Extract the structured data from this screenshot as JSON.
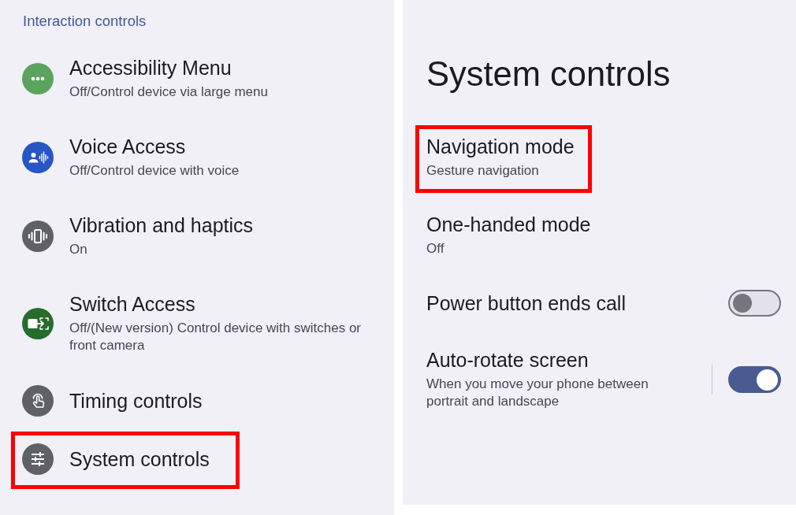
{
  "left_panel": {
    "section_header": "Interaction controls",
    "items": [
      {
        "title": "Accessibility Menu",
        "subtitle": "Off/Control device via large menu",
        "color": "#5ba35e",
        "highlighted": false
      },
      {
        "title": "Voice Access",
        "subtitle": "Off/Control device with voice",
        "color": "#2756c5",
        "highlighted": false
      },
      {
        "title": "Vibration and haptics",
        "subtitle": "On",
        "color": "#5f6166",
        "highlighted": false
      },
      {
        "title": "Switch Access",
        "subtitle": "Off/(New version) Control device with switches or front camera",
        "color": "#266c2c",
        "highlighted": false
      },
      {
        "title": "Timing controls",
        "color": "#5f6166",
        "highlighted": false
      },
      {
        "title": "System controls",
        "color": "#5f6166",
        "highlighted": true
      }
    ]
  },
  "right_panel": {
    "title": "System controls",
    "items": [
      {
        "kind": "link",
        "title": "Navigation mode",
        "subtitle": "Gesture navigation",
        "highlighted": true
      },
      {
        "kind": "link",
        "title": "One-handed mode",
        "subtitle": "Off",
        "highlighted": false
      },
      {
        "kind": "toggle",
        "title": "Power button ends call",
        "on": false,
        "highlighted": false
      },
      {
        "kind": "split_toggle",
        "title": "Auto-rotate screen",
        "subtitle": "When you move your phone between portrait and landscape",
        "on": true,
        "highlighted": false
      }
    ]
  }
}
